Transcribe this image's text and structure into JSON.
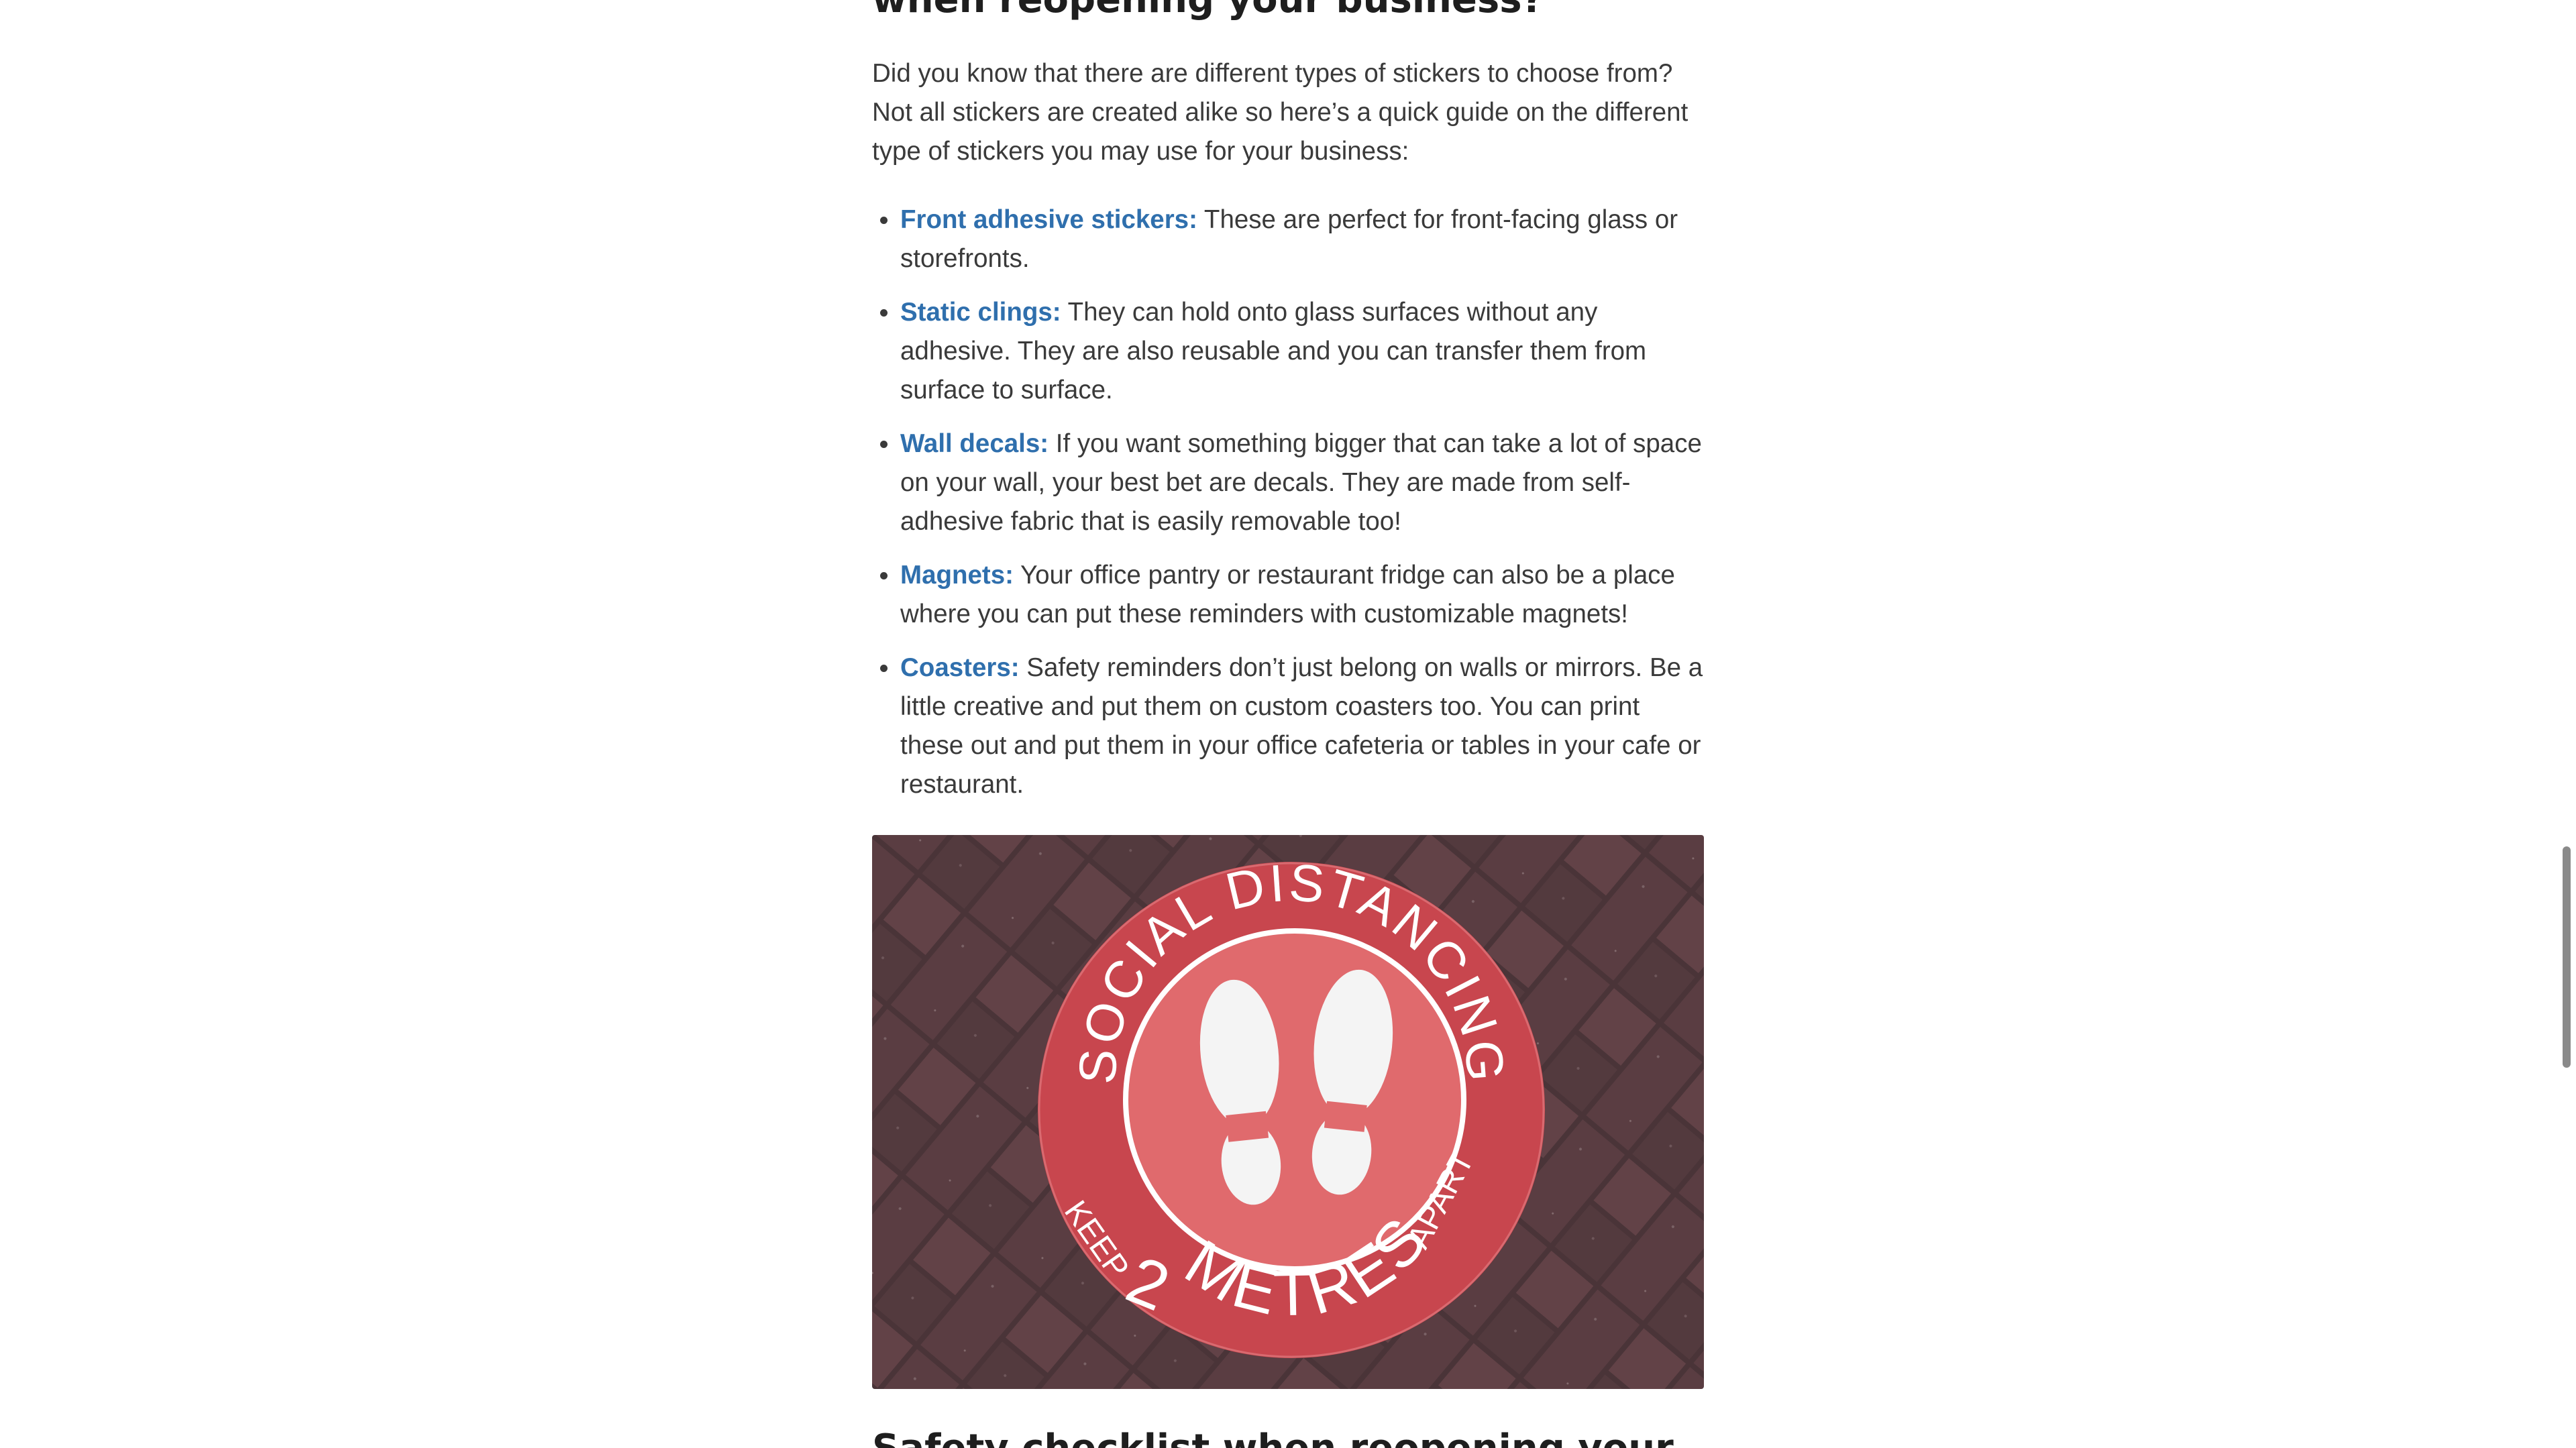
{
  "article": {
    "heading_top": "when reopening your business?",
    "intro": "Did you know that there are different types of stickers to choose from? Not all stickers are created alike so here’s a quick guide on the different type of stickers you may use for your business:",
    "sticker_types": [
      {
        "term": "Front adhesive stickers:",
        "text": " These are perfect for front-facing glass or storefronts."
      },
      {
        "term": "Static clings:",
        "text": " They can hold onto glass surfaces without any adhesive. They are also reusable and you can transfer them from surface to surface."
      },
      {
        "term": "Wall decals:",
        "text": " If you want something bigger that can take a lot of space on your wall, your best bet are decals. They are made from self-adhesive fabric that is easily removable too!"
      },
      {
        "term": "Magnets:",
        "text": " Your office pantry or restaurant fridge can also be a place where you can put these reminders with customizable magnets!"
      },
      {
        "term": "Coasters:",
        "text": " Safety reminders don’t just belong on walls or mirrors. Be a little creative and put them on custom coasters too. You can print these out and put them in your office cafeteria or tables in your cafe or restaurant."
      }
    ],
    "photo": {
      "sign_top_text": "SOCIAL DISTANCING",
      "sign_left_text": "KEEP",
      "sign_number": "2",
      "sign_bottom_text": "METRES",
      "sign_right_text": "APART",
      "sign_color": "#c8464e",
      "brick_color": "#4a3438"
    },
    "heading_bottom": "Safety checklist when reopening your"
  },
  "colors": {
    "link": "#2f6fad",
    "text": "#3a3a3a",
    "heading": "#1e1e1e",
    "background": "#ffffff"
  }
}
